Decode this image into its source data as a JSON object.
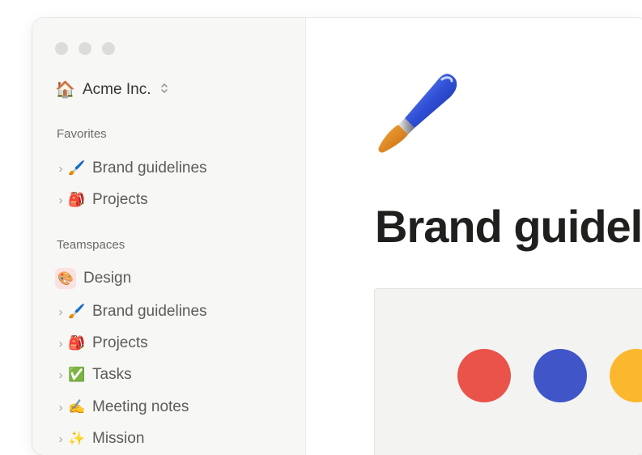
{
  "workspace": {
    "icon": "🏠",
    "name": "Acme Inc.",
    "switcher_icon": "⌃⌄"
  },
  "favorites": {
    "label": "Favorites",
    "items": [
      {
        "icon": "🖌️",
        "label": "Brand guidelines"
      },
      {
        "icon": "🎒",
        "label": "Projects"
      }
    ]
  },
  "teamspaces": {
    "label": "Teamspaces",
    "team": {
      "icon": "🎨",
      "label": "Design"
    },
    "items": [
      {
        "icon": "🖌️",
        "label": "Brand guidelines"
      },
      {
        "icon": "🎒",
        "label": "Projects"
      },
      {
        "icon": "✅",
        "label": "Tasks"
      },
      {
        "icon": "✍️",
        "label": "Meeting notes"
      },
      {
        "icon": "✨",
        "label": "Mission"
      }
    ]
  },
  "chevron": "›",
  "page": {
    "title": "Brand guidelines",
    "icon_name": "paintbrush-icon"
  },
  "colors": {
    "red": "#e9534a",
    "blue": "#3f55c8",
    "yellow": "#fbb82e"
  }
}
